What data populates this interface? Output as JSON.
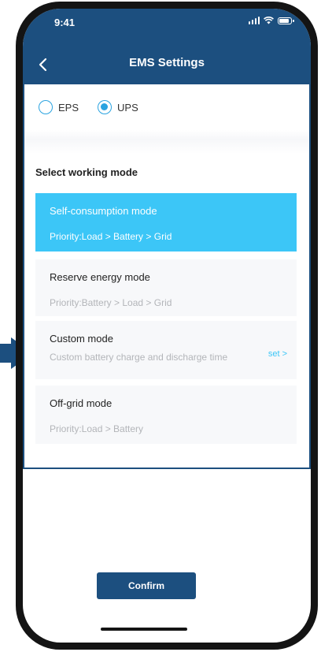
{
  "status_bar": {
    "time": "9:41"
  },
  "header": {
    "title": "EMS Settings",
    "back_icon": "chevron-left-icon"
  },
  "power_mode": {
    "options": [
      {
        "label": "EPS",
        "selected": false
      },
      {
        "label": "UPS",
        "selected": true
      }
    ]
  },
  "working_mode": {
    "section_title": "Select working mode",
    "modes": [
      {
        "name": "Self-consumption mode",
        "description": "Priority:Load > Battery > Grid",
        "selected": true
      },
      {
        "name": "Reserve energy mode",
        "description": "Priority:Battery > Load > Grid",
        "selected": false
      },
      {
        "name": "Custom mode",
        "description": "Custom battery charge and discharge time",
        "selected": false,
        "action": "set >"
      },
      {
        "name": "Off-grid mode",
        "description": "Priority:Load > Battery",
        "selected": false
      }
    ]
  },
  "footer": {
    "confirm_label": "Confirm"
  },
  "colors": {
    "header_blue": "#1c4f7f",
    "accent_cyan": "#3cc6f7",
    "card_bg": "#f7f8fa",
    "muted_text": "#b3b5b9"
  }
}
